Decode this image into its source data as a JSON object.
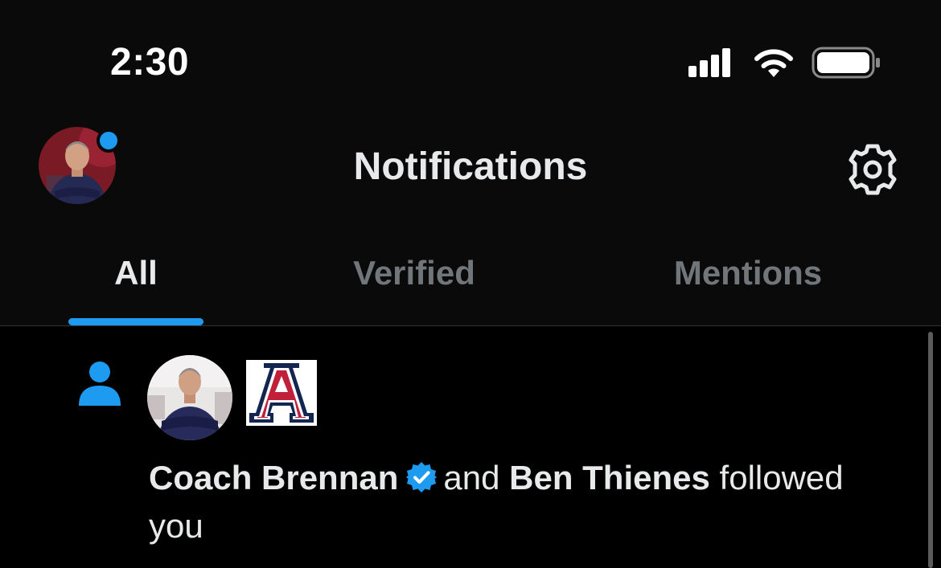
{
  "status_bar": {
    "time": "2:30",
    "icons": [
      "cellular-signal-icon",
      "wifi-icon",
      "battery-icon"
    ]
  },
  "header": {
    "title": "Notifications",
    "avatar": "profile-avatar",
    "settings_icon": "gear-icon"
  },
  "tabs": [
    {
      "label": "All",
      "active": true
    },
    {
      "label": "Verified",
      "active": false
    },
    {
      "label": "Mentions",
      "active": false
    }
  ],
  "notification": {
    "type_icon": "person-icon",
    "user1": "Coach Brennan",
    "conjunction": "and",
    "user2": "Ben Thienes",
    "action": "followed you"
  },
  "colors": {
    "accent": "#1d9bf0",
    "background": "#000000",
    "header_background": "#0a0a0a",
    "text_primary": "#e7e9ea",
    "text_secondary": "#71767b",
    "arizona_red": "#c1203b",
    "arizona_navy": "#13264f"
  }
}
